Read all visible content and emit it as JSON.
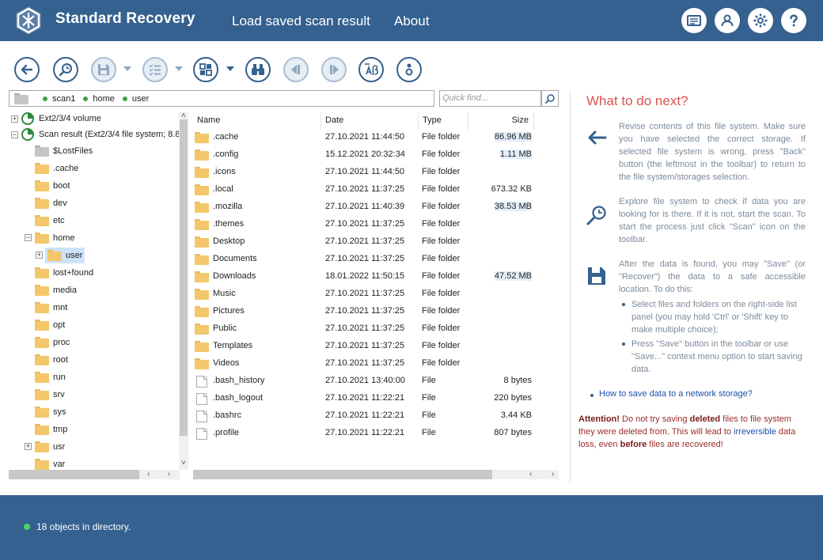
{
  "header": {
    "title": "Standard Recovery",
    "menu": [
      "Load saved scan result",
      "About"
    ],
    "buttons": [
      "console-icon",
      "user-icon",
      "settings-icon",
      "help-icon"
    ]
  },
  "toolbar": {
    "buttons": [
      "back-icon",
      "explore-icon",
      "save-icon",
      "checklist-icon",
      "view-icon",
      "find-icon",
      "prev-icon",
      "next-icon",
      "text-icon",
      "info-icon"
    ]
  },
  "path": {
    "crumbs": [
      "scan1",
      "home",
      "user"
    ]
  },
  "quickfind": {
    "placeholder": "Quick find..."
  },
  "tree": {
    "items": [
      "Ext2/3/4 volume",
      "Scan result (Ext2/3/4 file system; 8.8",
      "$LostFiles",
      ".cache",
      "boot",
      "dev",
      "etc",
      "home",
      "user",
      "lost+found",
      "media",
      "mnt",
      "opt",
      "proc",
      "root",
      "run",
      "srv",
      "sys",
      "tmp",
      "usr",
      "var"
    ]
  },
  "list": {
    "columns": [
      "Name",
      "Date",
      "Type",
      "Size"
    ],
    "rows": [
      {
        "name": ".cache",
        "date": "27.10.2021 11:44:50",
        "type": "File folder",
        "size": "86.96 MB"
      },
      {
        "name": ".config",
        "date": "15.12.2021 20:32:34",
        "type": "File folder",
        "size": "1.11 MB"
      },
      {
        "name": ".icons",
        "date": "27.10.2021 11:44:50",
        "type": "File folder",
        "size": ""
      },
      {
        "name": ".local",
        "date": "27.10.2021 11:37:25",
        "type": "File folder",
        "size": "673.32 KB"
      },
      {
        "name": ".mozilla",
        "date": "27.10.2021 11:40:39",
        "type": "File folder",
        "size": "38.53 MB"
      },
      {
        "name": ".themes",
        "date": "27.10.2021 11:37:25",
        "type": "File folder",
        "size": ""
      },
      {
        "name": "Desktop",
        "date": "27.10.2021 11:37:25",
        "type": "File folder",
        "size": ""
      },
      {
        "name": "Documents",
        "date": "27.10.2021 11:37:25",
        "type": "File folder",
        "size": ""
      },
      {
        "name": "Downloads",
        "date": "18.01.2022 11:50:15",
        "type": "File folder",
        "size": "47.52 MB"
      },
      {
        "name": "Music",
        "date": "27.10.2021 11:37:25",
        "type": "File folder",
        "size": ""
      },
      {
        "name": "Pictures",
        "date": "27.10.2021 11:37:25",
        "type": "File folder",
        "size": ""
      },
      {
        "name": "Public",
        "date": "27.10.2021 11:37:25",
        "type": "File folder",
        "size": ""
      },
      {
        "name": "Templates",
        "date": "27.10.2021 11:37:25",
        "type": "File folder",
        "size": ""
      },
      {
        "name": "Videos",
        "date": "27.10.2021 11:37:25",
        "type": "File folder",
        "size": ""
      },
      {
        "name": ".bash_history",
        "date": "27.10.2021 13:40:00",
        "type": "File",
        "size": "8 bytes"
      },
      {
        "name": ".bash_logout",
        "date": "27.10.2021 11:22:21",
        "type": "File",
        "size": "220 bytes"
      },
      {
        "name": ".bashrc",
        "date": "27.10.2021 11:22:21",
        "type": "File",
        "size": "3.44 KB"
      },
      {
        "name": ".profile",
        "date": "27.10.2021 11:22:21",
        "type": "File",
        "size": "807 bytes"
      }
    ]
  },
  "help": {
    "title": "What to do next?",
    "p1": "Revise contents of this file system. Make sure you have selected the correct storage. If selected file system is wrong, press \"Back\" button (the leftmost in the toolbar) to return to the file system/storages selection.",
    "p2": "Explore file system to check if data you are looking for is there. If it is not, start the scan. To start the process just click \"Scan\" icon on the toolbar.",
    "p3": "After the data is found, you may \"Save\" (or \"Recover\") the data to a safe accessible location. To do this:",
    "bullets": [
      "Select files and folders on the right-side list panel (you may hold 'Ctrl' or 'Shift' key to make multiple choice);",
      "Press \"Save\" button in the toolbar or use \"Save...\" context menu option to start saving data."
    ],
    "link": "How to save data to a network storage?",
    "attention_label": "Attention!",
    "attention_1": " Do not try saving ",
    "attention_bold1": "deleted",
    "attention_2": " files to file system they were deleted from. This will lead to ",
    "attention_blue": "irreversible",
    "attention_3": " data loss, even ",
    "attention_bold2": "before",
    "attention_4": " files are recovered!"
  },
  "status": {
    "text": "18 objects in directory."
  },
  "colors": {
    "brand": "#34618f",
    "accent": "#d9534f",
    "status_ok": "#4cd163"
  }
}
